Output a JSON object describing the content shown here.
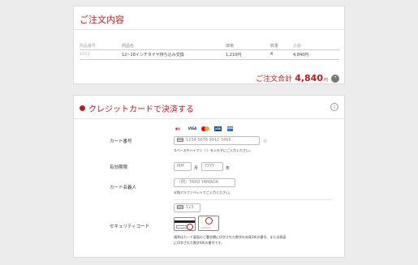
{
  "order": {
    "title": "ご注文内容",
    "columns": [
      "商品番号",
      "商品名",
      "価格",
      "数量",
      "小計"
    ],
    "row": {
      "id": "1001",
      "name": "12~18インチタイヤ持ち込み交換",
      "price": "1,210円",
      "qty": "4",
      "subtotal": "4,840円"
    },
    "total_label": "ご注文合計",
    "total_value": "4,840",
    "total_unit": "円",
    "collapse_glyph": "⌃"
  },
  "payment": {
    "title": "クレジットカードで決済する",
    "info_glyph": "i",
    "brands": [
      "楽天",
      "VISA",
      "",
      "JCB",
      "AMEX"
    ],
    "card_number": {
      "label": "カード番号",
      "placeholder": "1234 5678 9012 3456",
      "hint": "スペースやハイフン（-）を入れずにご入力ください。"
    },
    "expiry": {
      "label": "有効期限",
      "month_placeholder": "MM",
      "month_unit": "月",
      "year_placeholder": "YYYY",
      "year_unit": "年"
    },
    "holder": {
      "label": "カード名義人",
      "placeholder": "（例）TARO YAMADA",
      "hint": "半角アルファベットでご入力ください。"
    },
    "security": {
      "label": "セキュリティコード",
      "placeholder": "123",
      "hint_line1": "通常はカード裏面のご署名欄に印字された数字の末尾3桁の番号、または表面",
      "hint_line2": "に印字された数字4桁の番号です。",
      "card_back_text": "cardname"
    }
  }
}
